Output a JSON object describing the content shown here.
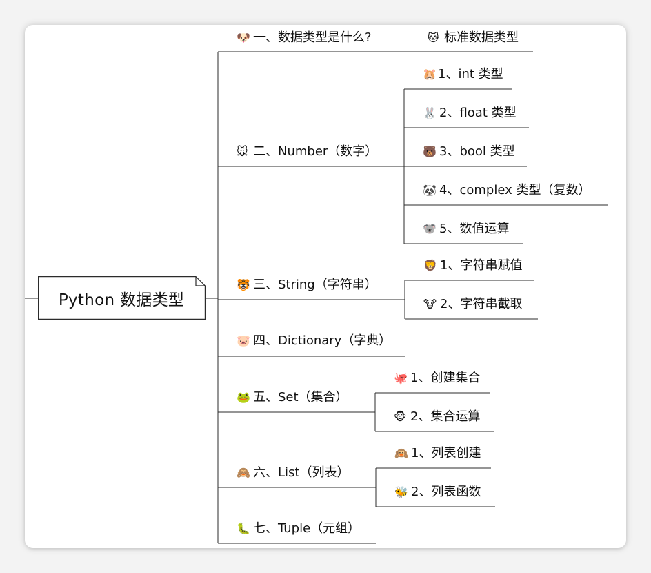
{
  "root": {
    "label": "Python 数据类型"
  },
  "branches": [
    {
      "emoji": "🐶",
      "label": "一、数据类型是什么?",
      "secondary": {
        "emoji": "🐱",
        "label": "标准数据类型"
      }
    },
    {
      "emoji": "🐭",
      "label": "二、Number（数字）",
      "children": [
        {
          "emoji": "🐹",
          "label": "1、int 类型"
        },
        {
          "emoji": "🐰",
          "label": "2、float 类型"
        },
        {
          "emoji": "🐻",
          "label": "3、bool 类型"
        },
        {
          "emoji": "🐼",
          "label": "4、complex 类型（复数）"
        },
        {
          "emoji": "🐨",
          "label": "5、数值运算"
        }
      ]
    },
    {
      "emoji": "🐯",
      "label": "三、String（字符串）",
      "children": [
        {
          "emoji": "🦁",
          "label": "1、字符串赋值"
        },
        {
          "emoji": "🐮",
          "label": "2、字符串截取"
        }
      ]
    },
    {
      "emoji": "🐷",
      "label": "四、Dictionary（字典）"
    },
    {
      "emoji": "🐸",
      "label": "五、Set（集合）",
      "children": [
        {
          "emoji": "🐙",
          "label": "1、创建集合"
        },
        {
          "emoji": "🐵",
          "label": "2、集合运算"
        }
      ]
    },
    {
      "emoji": "🙈",
      "label": "六、List（列表）",
      "children": [
        {
          "emoji": "🙉",
          "label": "1、列表创建"
        },
        {
          "emoji": "🐝",
          "label": "2、列表函数"
        }
      ]
    },
    {
      "emoji": "🐛",
      "label": "七、Tuple（元组）"
    }
  ]
}
